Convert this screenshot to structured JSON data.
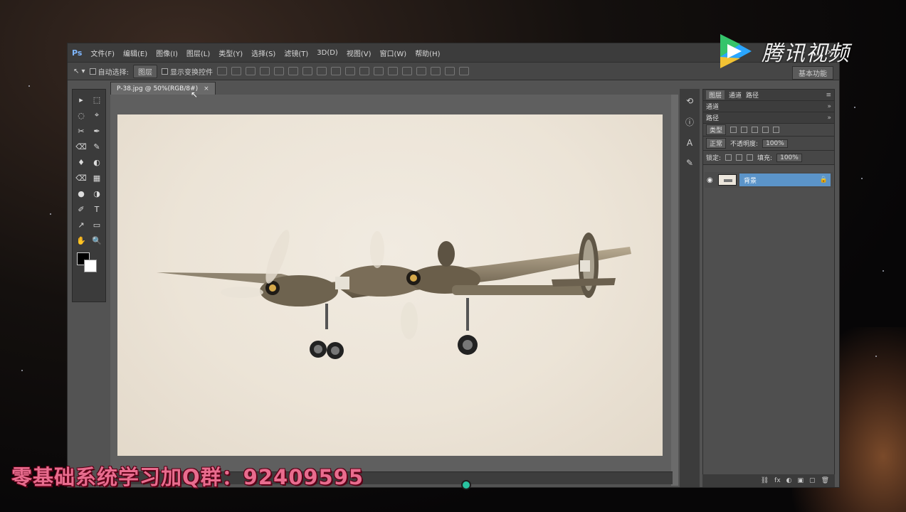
{
  "app": {
    "logo": "Ps",
    "menu": [
      "文件(F)",
      "编辑(E)",
      "图像(I)",
      "图层(L)",
      "类型(Y)",
      "选择(S)",
      "滤镜(T)",
      "3D(D)",
      "视图(V)",
      "窗口(W)",
      "帮助(H)"
    ],
    "window_controls": [
      "—",
      "□",
      "✕"
    ]
  },
  "options": {
    "tool": "↖ ▾",
    "mode": "自动选择:",
    "target": "图层",
    "show_transform": "显示变换控件",
    "workspace": "基本功能"
  },
  "document": {
    "tab_label": "P-38.jpg @ 50%(RGB/8#)",
    "close": "×"
  },
  "tools": [
    "▸",
    "⬚",
    "◌",
    "⌖",
    "✂",
    "✒",
    "⌫",
    "✎",
    "♦",
    "◐",
    "✐",
    "T",
    "↗",
    "▭",
    "✋",
    "🔍",
    "⟲",
    "◑",
    "●",
    "▦"
  ],
  "panels": {
    "header_tabs": [
      "图层",
      "通道",
      "路径"
    ],
    "filter_label": "类型",
    "blend_mode": "正常",
    "opacity_label": "不透明度:",
    "opacity_value": "100%",
    "lock_label": "锁定:",
    "fill_label": "填充:",
    "fill_value": "100%",
    "layer_name": "背景",
    "lock_icon": "🔒",
    "bottom_icons": [
      "⛓",
      "fx",
      "◐",
      "▣",
      "▢",
      "🗑"
    ]
  },
  "watermark": {
    "text": "腾讯视频",
    "colors": {
      "blue": "#2aa6ff",
      "green": "#35c46b",
      "yellow": "#f2c233",
      "orange": "#ff7a2e"
    }
  },
  "banner": {
    "text": "零基础系统学习加Q群：92409595",
    "color": "#e86c8e"
  }
}
